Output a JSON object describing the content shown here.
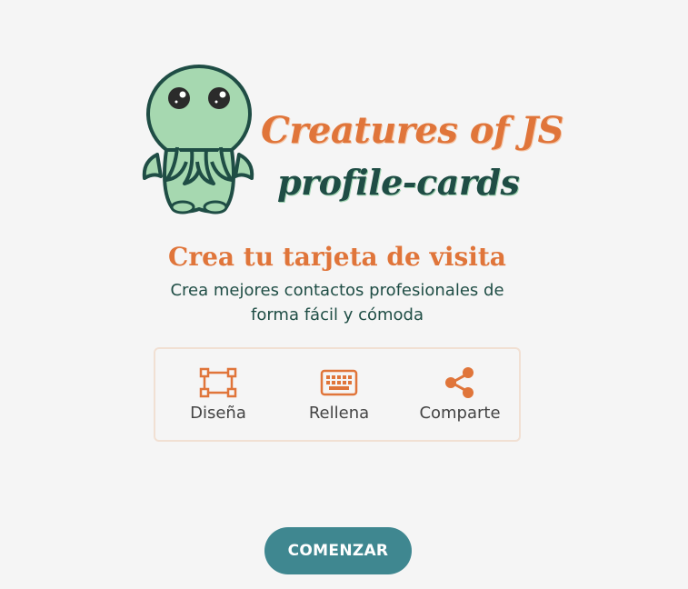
{
  "logo": {
    "title_line1": "Creatures of JS",
    "title_line2": "profile-cards",
    "mascot_icon": "cthulhu-mascot"
  },
  "hero": {
    "headline": "Crea tu tarjeta de visita",
    "subtitle": "Crea mejores contactos profesionales de forma fácil y cómoda"
  },
  "steps": [
    {
      "icon": "design-frame-icon",
      "label": "Diseña"
    },
    {
      "icon": "keyboard-icon",
      "label": "Rellena"
    },
    {
      "icon": "share-icon",
      "label": "Comparte"
    }
  ],
  "cta": {
    "label": "COMENZAR"
  },
  "colors": {
    "background": "#f5f5f5",
    "accent_orange": "#e0753a",
    "dark_green": "#1f4d45",
    "mascot_green": "#a6d8b0",
    "button_teal": "#3f8790"
  }
}
